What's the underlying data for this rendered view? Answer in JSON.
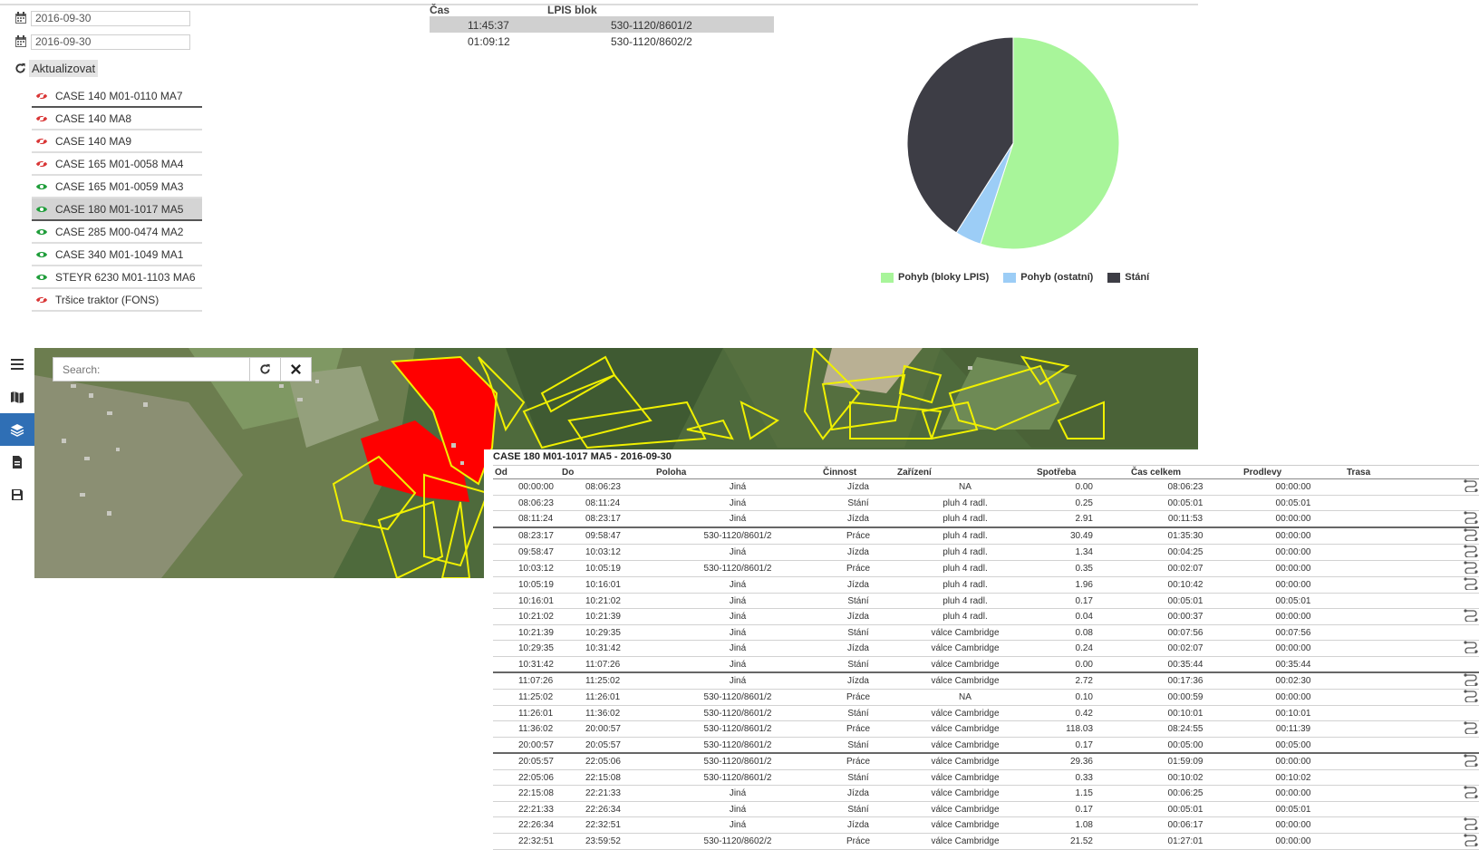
{
  "dates": [
    "2016-09-30",
    "2016-09-30"
  ],
  "refresh_label": "Aktualizovat",
  "vehicles": [
    {
      "label": "CASE 140 M01-0110 MA7",
      "visible": false
    },
    {
      "label": "CASE 140 MA8",
      "visible": false
    },
    {
      "label": "CASE 140 MA9",
      "visible": false
    },
    {
      "label": "CASE 165 M01-0058 MA4",
      "visible": false
    },
    {
      "label": "CASE 165 M01-0059 MA3",
      "visible": true
    },
    {
      "label": "CASE 180 M01-1017 MA5",
      "visible": true,
      "selected": true
    },
    {
      "label": "CASE 285 M00-0474 MA2",
      "visible": true
    },
    {
      "label": "CASE 340 M01-1049 MA1",
      "visible": true
    },
    {
      "label": "STEYR 6230 M01-1103 MA6",
      "visible": true
    },
    {
      "label": "Tršice traktor (FONS)",
      "visible": false
    }
  ],
  "lpis_table": {
    "headers": [
      "Čas",
      "LPIS blok"
    ],
    "rows": [
      {
        "time": "11:45:37",
        "block": "530-1120/8601/2"
      },
      {
        "time": "01:09:12",
        "block": "530-1120/8602/2"
      }
    ]
  },
  "chart_data": {
    "type": "pie",
    "labels": [
      "Pohyb (bloky LPIS)",
      "Pohyb (ostatní)",
      "Stání"
    ],
    "values": [
      55,
      4,
      41
    ],
    "colors": [
      "#a8f59a",
      "#9ccdf6",
      "#3d3d45"
    ]
  },
  "map": {
    "search_placeholder": "Search:",
    "colors": {
      "parcel_outline": "#f0f000",
      "highlight": "#ff0000"
    }
  },
  "sidebar_icons": [
    "menu-icon",
    "map-icon",
    "layers-icon",
    "document-icon",
    "save-icon"
  ],
  "detail": {
    "title": "CASE 180 M01-1017 MA5 - 2016-09-30",
    "headers": [
      "Od",
      "Do",
      "Poloha",
      "Činnost",
      "Zařízení",
      "Spotřeba",
      "Čas celkem",
      "Prodlevy",
      "Trasa"
    ],
    "rows": [
      [
        "00:00:00",
        "08:06:23",
        "Jiná",
        "Jízda",
        "NA",
        "0.00",
        "08:06:23",
        "00:00:00",
        true
      ],
      [
        "08:06:23",
        "08:11:24",
        "Jiná",
        "Stání",
        "pluh 4 radl.",
        "0.25",
        "00:05:01",
        "00:05:01",
        false
      ],
      [
        "08:11:24",
        "08:23:17",
        "Jiná",
        "Jízda",
        "pluh 4 radl.",
        "2.91",
        "00:11:53",
        "00:00:00",
        true
      ],
      [
        "08:23:17",
        "09:58:47",
        "530-1120/8601/2",
        "Práce",
        "pluh 4 radl.",
        "30.49",
        "01:35:30",
        "00:00:00",
        true
      ],
      [
        "09:58:47",
        "10:03:12",
        "Jiná",
        "Jízda",
        "pluh 4 radl.",
        "1.34",
        "00:04:25",
        "00:00:00",
        true
      ],
      [
        "10:03:12",
        "10:05:19",
        "530-1120/8601/2",
        "Práce",
        "pluh 4 radl.",
        "0.35",
        "00:02:07",
        "00:00:00",
        true
      ],
      [
        "10:05:19",
        "10:16:01",
        "Jiná",
        "Jízda",
        "pluh 4 radl.",
        "1.96",
        "00:10:42",
        "00:00:00",
        true
      ],
      [
        "10:16:01",
        "10:21:02",
        "Jiná",
        "Stání",
        "pluh 4 radl.",
        "0.17",
        "00:05:01",
        "00:05:01",
        false
      ],
      [
        "10:21:02",
        "10:21:39",
        "Jiná",
        "Jízda",
        "pluh 4 radl.",
        "0.04",
        "00:00:37",
        "00:00:00",
        true
      ],
      [
        "10:21:39",
        "10:29:35",
        "Jiná",
        "Stání",
        "válce Cambridge",
        "0.08",
        "00:07:56",
        "00:07:56",
        false
      ],
      [
        "10:29:35",
        "10:31:42",
        "Jiná",
        "Jízda",
        "válce Cambridge",
        "0.24",
        "00:02:07",
        "00:00:00",
        true
      ],
      [
        "10:31:42",
        "11:07:26",
        "Jiná",
        "Stání",
        "válce Cambridge",
        "0.00",
        "00:35:44",
        "00:35:44",
        false
      ],
      [
        "11:07:26",
        "11:25:02",
        "Jiná",
        "Jízda",
        "válce Cambridge",
        "2.72",
        "00:17:36",
        "00:02:30",
        true
      ],
      [
        "11:25:02",
        "11:26:01",
        "530-1120/8601/2",
        "Práce",
        "NA",
        "0.10",
        "00:00:59",
        "00:00:00",
        true
      ],
      [
        "11:26:01",
        "11:36:02",
        "530-1120/8601/2",
        "Stání",
        "válce Cambridge",
        "0.42",
        "00:10:01",
        "00:10:01",
        false
      ],
      [
        "11:36:02",
        "20:00:57",
        "530-1120/8601/2",
        "Práce",
        "válce Cambridge",
        "118.03",
        "08:24:55",
        "00:11:39",
        true
      ],
      [
        "20:00:57",
        "20:05:57",
        "530-1120/8601/2",
        "Stání",
        "válce Cambridge",
        "0.17",
        "00:05:00",
        "00:05:00",
        false
      ],
      [
        "20:05:57",
        "22:05:06",
        "530-1120/8601/2",
        "Práce",
        "válce Cambridge",
        "29.36",
        "01:59:09",
        "00:00:00",
        true
      ],
      [
        "22:05:06",
        "22:15:08",
        "530-1120/8601/2",
        "Stání",
        "válce Cambridge",
        "0.33",
        "00:10:02",
        "00:10:02",
        false
      ],
      [
        "22:15:08",
        "22:21:33",
        "Jiná",
        "Jízda",
        "válce Cambridge",
        "1.15",
        "00:06:25",
        "00:00:00",
        true
      ],
      [
        "22:21:33",
        "22:26:34",
        "Jiná",
        "Stání",
        "válce Cambridge",
        "0.17",
        "00:05:01",
        "00:05:01",
        false
      ],
      [
        "22:26:34",
        "22:32:51",
        "Jiná",
        "Jízda",
        "válce Cambridge",
        "1.08",
        "00:06:17",
        "00:00:00",
        true
      ],
      [
        "22:32:51",
        "23:59:52",
        "530-1120/8602/2",
        "Práce",
        "válce Cambridge",
        "21.52",
        "01:27:01",
        "00:00:00",
        true
      ]
    ]
  }
}
